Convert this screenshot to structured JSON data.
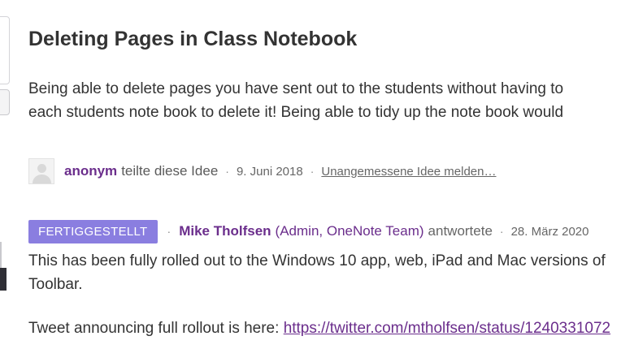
{
  "idea": {
    "title": "Deleting Pages in Class Notebook",
    "description_lines": [
      "Being able to delete pages you have sent out to the students without having to",
      "each students note book to delete it! Being able to tidy up the note book would"
    ]
  },
  "meta": {
    "author": "anonym",
    "action": "teilte diese Idee",
    "separator": "·",
    "date": "9. Juni 2018",
    "report_link": "Unangemessene Idee melden…"
  },
  "response": {
    "status_badge": "FERTIGGESTELLT",
    "separator": "·",
    "responder_name": "Mike Tholfsen",
    "responder_role": "(Admin, OneNote Team)",
    "action": "antwortete",
    "date": "28. März 2020",
    "body_lines": [
      "This has been fully rolled out to the Windows 10 app, web, iPad and Mac versions of",
      "Toolbar."
    ],
    "tweet_prefix": "Tweet announcing full rollout is here: ",
    "tweet_link": "https://twitter.com/mtholfsen/status/1240331072"
  },
  "colors": {
    "accent_purple": "#6b2e8c",
    "badge_bg": "#8a7ee0",
    "text": "#333333",
    "muted": "#666666"
  }
}
